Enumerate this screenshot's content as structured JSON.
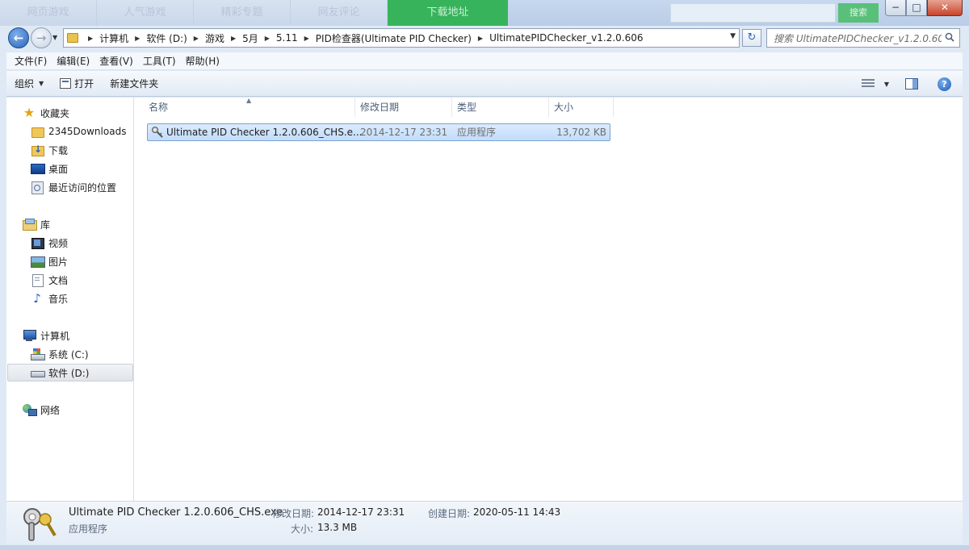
{
  "background_tabs": {
    "tab1": "网页游戏",
    "tab2": "人气游戏",
    "tab3": "精彩专题",
    "tab4": "网友评论",
    "download": "下载地址",
    "search_go": "搜索"
  },
  "navigation": {
    "breadcrumbs": [
      "计算机",
      "软件 (D:)",
      "游戏",
      "5月",
      "5.11",
      "PID检查器(Ultimate PID Checker)",
      "UltimatePIDChecker_v1.2.0.606"
    ],
    "search_placeholder": "搜索 UltimatePIDChecker_v1.2.0.606"
  },
  "menu": [
    "文件(F)",
    "编辑(E)",
    "查看(V)",
    "工具(T)",
    "帮助(H)"
  ],
  "toolbar": {
    "organize": "组织",
    "open": "打开",
    "new_folder": "新建文件夹"
  },
  "sidebar": {
    "favorites": {
      "label": "收藏夹",
      "items": [
        "2345Downloads",
        "下载",
        "桌面",
        "最近访问的位置"
      ]
    },
    "libraries": {
      "label": "库",
      "items": [
        "视频",
        "图片",
        "文档",
        "音乐"
      ]
    },
    "computer": {
      "label": "计算机",
      "items": [
        "系统 (C:)",
        "软件 (D:)"
      ],
      "selected": "软件 (D:)"
    },
    "network": {
      "label": "网络"
    }
  },
  "columns": {
    "name": "名称",
    "date": "修改日期",
    "type": "类型",
    "size": "大小"
  },
  "files": [
    {
      "name": "Ultimate PID Checker 1.2.0.606_CHS.e...",
      "date": "2014-12-17 23:31",
      "type": "应用程序",
      "size": "13,702 KB",
      "selected": true
    }
  ],
  "details": {
    "filename": "Ultimate PID Checker 1.2.0.606_CHS.exe",
    "file_type": "应用程序",
    "modified_label": "修改日期:",
    "modified_value": "2014-12-17 23:31",
    "size_label": "大小:",
    "size_value": "13.3 MB",
    "created_label": "创建日期:",
    "created_value": "2020-05-11 14:43"
  },
  "colors": {
    "selection_bg": "#cce8ff",
    "selection_border": "#7da2ce",
    "accent": "#2a63b8"
  }
}
